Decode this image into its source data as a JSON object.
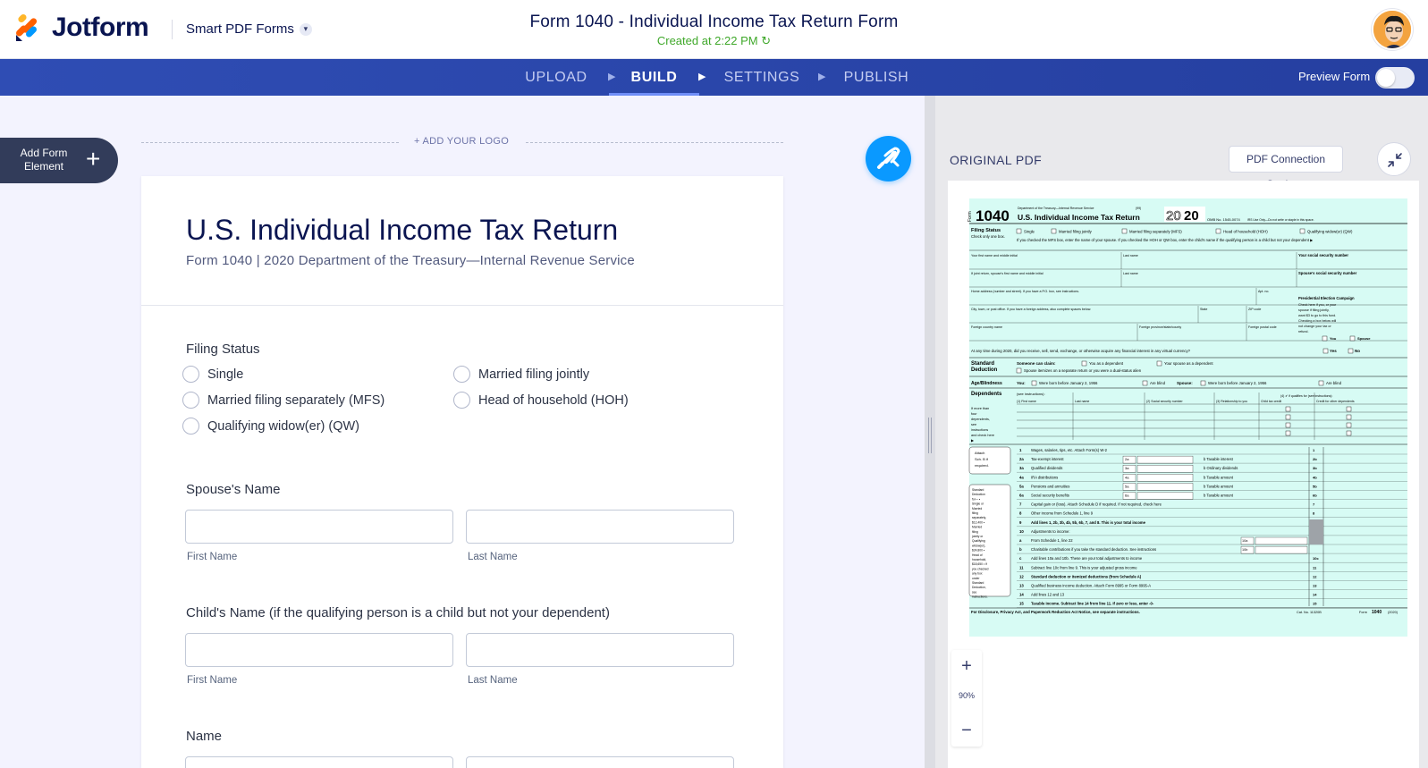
{
  "app": {
    "brand": "Jotform",
    "product_switcher": "Smart PDF Forms",
    "form_title": "Form 1040 - Individual Income Tax Return Form",
    "created_status": "Created at 2:22 PM",
    "colors": {
      "brand_navy": "#0a1551",
      "nav_blue": "#2f4db4",
      "accent_blue": "#0a99ff",
      "success_green": "#3fa82a",
      "pdf_tint": "#d7fbf4"
    }
  },
  "nav": {
    "tabs": [
      {
        "label": "UPLOAD",
        "active": false
      },
      {
        "label": "BUILD",
        "active": true
      },
      {
        "label": "SETTINGS",
        "active": false
      },
      {
        "label": "PUBLISH",
        "active": false
      }
    ],
    "preview_label": "Preview Form",
    "preview_enabled": false
  },
  "builder": {
    "add_element": {
      "line1": "Add Form",
      "line2": "Element",
      "icon": "plus-icon"
    },
    "add_logo": "+ ADD YOUR LOGO",
    "fab_icon": "paint-roller-icon",
    "form": {
      "heading": "U.S. Individual Income Tax Return",
      "subheading": "Form 1040 | 2020  Department of the Treasury—Internal Revenue Service",
      "filing_status": {
        "label": "Filing Status",
        "options": [
          "Single",
          "Married filing jointly",
          "Married filing separately (MFS)",
          "Head of household (HOH)",
          "Qualifying widow(er) (QW)"
        ]
      },
      "spouse_name": {
        "label": "Spouse's Name",
        "first": "First Name",
        "last": "Last Name"
      },
      "child_name": {
        "label": "Child's Name (if the qualifying person is a child but not your dependent)",
        "first": "First Name",
        "last": "Last Name"
      },
      "name": {
        "label": "Name"
      }
    }
  },
  "pdf": {
    "panel_title": "ORIGINAL PDF",
    "settings_button": "PDF Connection Settings",
    "collapse_icon": "collapse-arrows-icon",
    "zoom": "90%",
    "zoom_in": "+",
    "zoom_out": "−",
    "doc": {
      "form_no": "1040",
      "form_prefix": "Form",
      "dept": "Department of the Treasury—Internal Revenue Service",
      "code": "(99)",
      "title": "U.S. Individual Income Tax Return",
      "year_a": "20",
      "year_b": "20",
      "omb": "OMB No. 1545-0074",
      "irs_use": "IRS Use Only—Do not write or staple in this space.",
      "filing_status": "Filing Status",
      "check_one": "Check only one box.",
      "fs_options": [
        "Single",
        "Married filing jointly",
        "Married filing separately (MFS)",
        "Head of household (HOH)",
        "Qualifying widow(er) (QW)"
      ],
      "mfs_note": "If you checked the MFS box, enter the name of your spouse. If you checked the HOH or QW box, enter the child's name if the qualifying person is a child but not your dependent ▶",
      "row_first": "Your first name and middle initial",
      "row_last": "Last name",
      "row_ssn": "Your social security number",
      "row_spouse": "If joint return, spouse's first name and middle initial",
      "row_spouse_last": "Last name",
      "row_spouse_ssn": "Spouse's social security number",
      "row_addr": "Home address (number and street). If you have a P.O. box, see instructions.",
      "row_apt": "Apt. no.",
      "pec": "Presidential Election Campaign",
      "pec_text": "Check here if you, or your spouse if filing jointly, want $3 to go to this fund. Checking a box below will not change your tax or refund.",
      "row_city": "City, town, or post office. If you have a foreign address, also complete spaces below.",
      "row_state": "State",
      "row_zip": "ZIP code",
      "row_fcountry": "Foreign country name",
      "row_fprov": "Foreign province/state/county",
      "row_fzip": "Foreign postal code",
      "you": "You",
      "spouse": "Spouse",
      "virtual": "At any time during 2020, did you receive, sell, send, exchange, or otherwise acquire any financial interest in any virtual currency?",
      "yes": "Yes",
      "no": "No",
      "std_ded": "Standard Deduction",
      "someone": "Someone can claim:",
      "as_dep": "You as a dependent",
      "spouse_dep": "Your spouse as a dependent",
      "itemizes": "Spouse itemizes on a separate return or you were a dual-status alien",
      "age": "Age/Blindness",
      "you_label": "You:",
      "born": "Were born before January 2, 1956",
      "blind": "Are blind",
      "spouse_label": "Spouse:",
      "dependents": "Dependents",
      "see_instr": "(see instructions):",
      "dep_more": "If more than four dependents, see instructions and check here ▶",
      "dep_cols": [
        "(1) First name",
        "Last name",
        "(2) Social security number",
        "(3) Relationship to you",
        "(4) ✔ if qualifies for (see instructions):",
        "Child tax credit",
        "Credit for other dependents"
      ],
      "attach": "Attach Sch. B if required.",
      "std_side": "Standard Deduction for— • Single or Married filing separately, $12,400 • Married filing jointly or Qualifying widow(er), $24,800 • Head of household, $18,650 • If you checked any box under Standard Deduction, see instructions.",
      "lines": [
        [
          "1",
          "Wages, salaries, tips, etc. Attach Form(s) W-2",
          "1"
        ],
        [
          "2a",
          "Tax-exempt interest",
          "2a"
        ],
        [
          "3a",
          "Qualified dividends",
          "3a"
        ],
        [
          "4a",
          "IRA distributions",
          "4a"
        ],
        [
          "5a",
          "Pensions and annuities",
          "5a"
        ],
        [
          "6a",
          "Social security benefits",
          "6a"
        ],
        [
          "7",
          "Capital gain or (loss). Attach Schedule D if required. If not required, check here",
          "7"
        ],
        [
          "8",
          "Other income from Schedule 1, line 9",
          "8"
        ],
        [
          "9",
          "Add lines 1, 2b, 3b, 4b, 5b, 6b, 7, and 8. This is your total income",
          "9"
        ],
        [
          "10",
          "Adjustments to income:",
          ""
        ],
        [
          "a",
          "From Schedule 1, line 22",
          "10a"
        ],
        [
          "b",
          "Charitable contributions if you take the standard deduction. See instructions",
          "10b"
        ],
        [
          "c",
          "Add lines 10a and 10b. These are your total adjustments to income",
          "10c"
        ],
        [
          "11",
          "Subtract line 10c from line 9. This is your adjusted gross income",
          "11"
        ],
        [
          "12",
          "Standard deduction or itemized deductions (from Schedule A)",
          "12"
        ],
        [
          "13",
          "Qualified business income deduction. Attach Form 8995 or Form 8995-A",
          "13"
        ],
        [
          "14",
          "Add lines 12 and 13",
          "14"
        ],
        [
          "15",
          "Taxable income. Subtract line 14 from line 11. If zero or less, enter -0-",
          "15"
        ]
      ],
      "b_lines": [
        "b Taxable interest",
        "b Ordinary dividends",
        "b Taxable amount",
        "b Taxable amount",
        "b Taxable amount"
      ],
      "b_codes": [
        "2b",
        "3b",
        "4b",
        "5b",
        "6b"
      ],
      "footer": "For Disclosure, Privacy Act, and Paperwork Reduction Act Notice, see separate instructions.",
      "cat": "Cat. No. 11320B",
      "footer_form": "Form",
      "footer_no": "1040",
      "footer_year": "(2020)"
    }
  }
}
